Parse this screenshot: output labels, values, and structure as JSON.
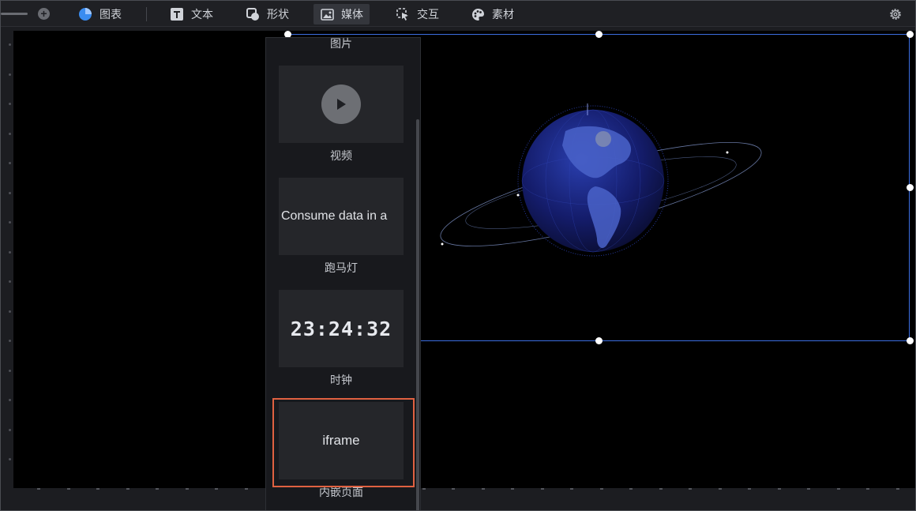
{
  "toolbar": {
    "zoom_in_glyph": "+",
    "items": [
      {
        "label": "图表",
        "icon": "pie-chart-icon"
      },
      {
        "label": "文本",
        "icon": "text-icon"
      },
      {
        "label": "形状",
        "icon": "shape-icon"
      },
      {
        "label": "媒体",
        "icon": "image-icon",
        "active": true
      },
      {
        "label": "交互",
        "icon": "pointer-icon"
      },
      {
        "label": "素材",
        "icon": "palette-icon"
      }
    ],
    "settings_icon": "gear-icon"
  },
  "media_panel": {
    "top_label": "图片",
    "items": [
      {
        "label": "视频",
        "preview": "play-icon"
      },
      {
        "label": "跑马灯",
        "preview_text": "Consume data in a"
      },
      {
        "label": "时钟",
        "preview_text": "23:24:32"
      },
      {
        "label": "内嵌页面",
        "preview_text": "iframe",
        "highlighted": true
      }
    ]
  },
  "colors": {
    "accent_blue": "#3b6de0",
    "highlight_border": "#e06141",
    "pie_icon_blue": "#3a8cf0"
  }
}
